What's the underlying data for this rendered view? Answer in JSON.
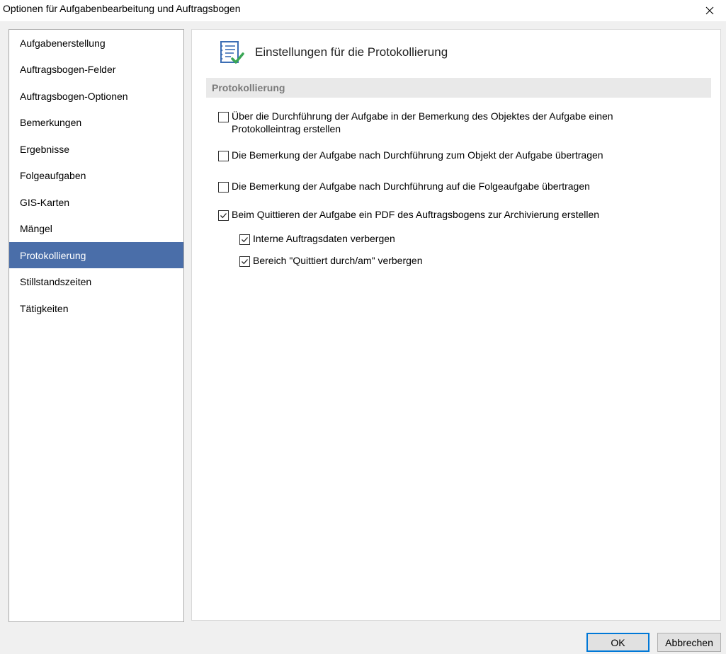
{
  "window": {
    "title": "Optionen für Aufgabenbearbeitung und Auftragsbogen"
  },
  "nav": {
    "items": [
      {
        "label": "Aufgabenerstellung",
        "selected": false
      },
      {
        "label": "Auftragsbogen-Felder",
        "selected": false
      },
      {
        "label": "Auftragsbogen-Optionen",
        "selected": false
      },
      {
        "label": "Bemerkungen",
        "selected": false
      },
      {
        "label": "Ergebnisse",
        "selected": false
      },
      {
        "label": "Folgeaufgaben",
        "selected": false
      },
      {
        "label": "GIS-Karten",
        "selected": false
      },
      {
        "label": "Mängel",
        "selected": false
      },
      {
        "label": "Protokollierung",
        "selected": true
      },
      {
        "label": "Stillstandszeiten",
        "selected": false
      },
      {
        "label": "Tätigkeiten",
        "selected": false
      }
    ]
  },
  "content": {
    "heading": "Einstellungen für die Protokollierung",
    "icon": "log-settings-icon",
    "section": "Protokollierung",
    "options": [
      {
        "label": "Über die Durchführung der Aufgabe in der Bemerkung des Objektes der Aufgabe einen Protokolleintrag erstellen",
        "checked": false
      },
      {
        "label": "Die Bemerkung der Aufgabe nach Durchführung zum Objekt der Aufgabe übertragen",
        "checked": false
      },
      {
        "label": "Die Bemerkung der Aufgabe nach Durchführung auf die Folgeaufgabe übertragen",
        "checked": false
      },
      {
        "label": "Beim Quittieren der Aufgabe ein PDF des Auftragsbogens zur Archivierung erstellen",
        "checked": true
      },
      {
        "label": "Interne Auftragsdaten verbergen",
        "checked": true
      },
      {
        "label": "Bereich \"Quittiert durch/am\" verbergen",
        "checked": true
      }
    ]
  },
  "buttons": {
    "ok": "OK",
    "cancel": "Abbrechen"
  },
  "colors": {
    "selection": "#4a6ea9",
    "default_button_border": "#0078d7",
    "icon_check": "#3aa655"
  }
}
